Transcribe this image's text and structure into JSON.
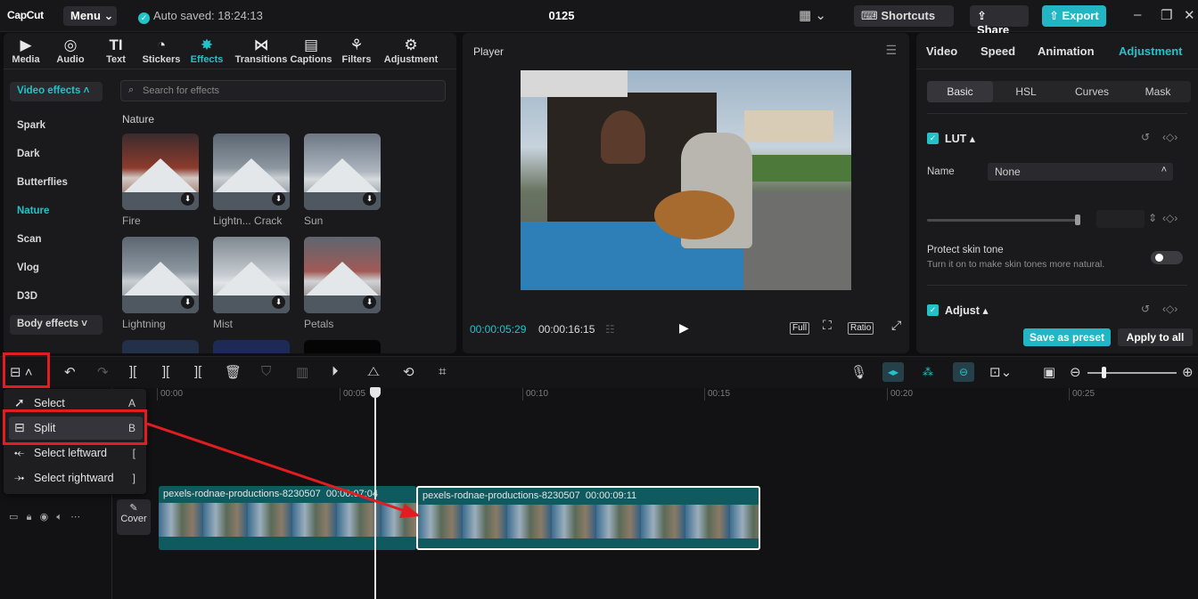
{
  "topbar": {
    "logo": "CapCut",
    "menu_label": "Menu ⌄",
    "autosave": "Auto saved: 18:24:13",
    "project_title": "0125",
    "shortcuts_label": "Shortcuts",
    "share_label": "Share",
    "export_label": "Export"
  },
  "media_tabs": [
    {
      "label": "Media",
      "icon": "media-icon"
    },
    {
      "label": "Audio",
      "icon": "audio-icon"
    },
    {
      "label": "Text",
      "icon": "text-icon"
    },
    {
      "label": "Stickers",
      "icon": "stickers-icon"
    },
    {
      "label": "Effects",
      "icon": "effects-icon"
    },
    {
      "label": "Transitions",
      "icon": "transitions-icon"
    },
    {
      "label": "Captions",
      "icon": "captions-icon"
    },
    {
      "label": "Filters",
      "icon": "filters-icon"
    },
    {
      "label": "Adjustment",
      "icon": "adjustment-icon"
    }
  ],
  "effects": {
    "category_button": "Video effects",
    "categories": [
      "Spark",
      "Dark",
      "Butterflies",
      "Nature",
      "Scan",
      "Vlog",
      "D3D"
    ],
    "body_effects_button": "Body effects",
    "search_placeholder": "Search for effects",
    "section_title": "Nature",
    "items": [
      "Fire",
      "Lightn... Crack",
      "Sun",
      "Lightning",
      "Mist",
      "Petals"
    ]
  },
  "player": {
    "title": "Player",
    "current_time": "00:00:05:29",
    "total_time": "00:00:16:15",
    "full_label": "Full",
    "ratio_label": "Ratio"
  },
  "right_panel": {
    "tabs": [
      "Video",
      "Speed",
      "Animation",
      "Adjustment"
    ],
    "subtabs": [
      "Basic",
      "HSL",
      "Curves",
      "Mask"
    ],
    "lut_label": "LUT ▴",
    "name_label": "Name",
    "name_value": "None",
    "protect_skin_title": "Protect skin tone",
    "protect_skin_desc": "Turn it on to make skin tones more natural.",
    "adjust_label": "Adjust ▴",
    "save_preset": "Save as preset",
    "apply_all": "Apply to all"
  },
  "timeline": {
    "ruler": [
      "00:00",
      "00:05",
      "00:10",
      "00:15",
      "00:20",
      "00:25"
    ],
    "cover_label": "Cover",
    "clip1": {
      "name": "pexels-rodnae-productions-8230507",
      "duration": "00:00:07:04"
    },
    "clip2": {
      "name": "pexels-rodnae-productions-8230507",
      "duration": "00:00:09:11"
    }
  },
  "dropdown": {
    "items": [
      {
        "label": "Select",
        "key": "A"
      },
      {
        "label": "Split",
        "key": "B"
      },
      {
        "label": "Select leftward",
        "key": "["
      },
      {
        "label": "Select rightward",
        "key": "]"
      }
    ]
  },
  "colors": {
    "accent": "#22c3c8",
    "annotation": "#e11d22"
  }
}
